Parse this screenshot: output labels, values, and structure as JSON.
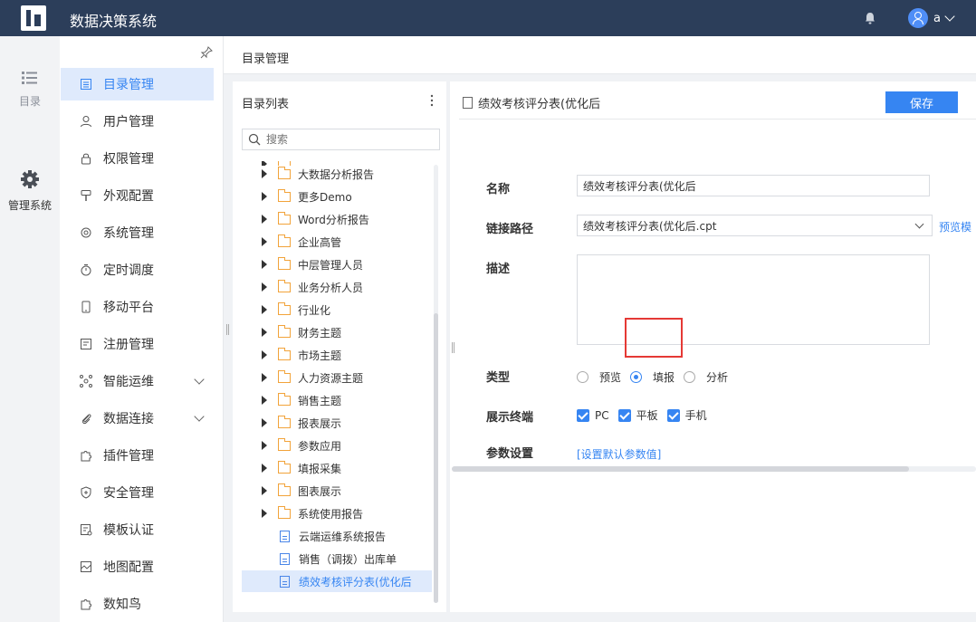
{
  "app": {
    "title": "数据决策系统",
    "user": "a"
  },
  "rail": [
    {
      "label": "目录",
      "icon": "list-icon"
    },
    {
      "label": "管理系统",
      "icon": "gear-icon"
    }
  ],
  "menu": [
    {
      "label": "目录管理",
      "icon": "directory-icon",
      "active": true
    },
    {
      "label": "用户管理",
      "icon": "user-icon"
    },
    {
      "label": "权限管理",
      "icon": "lock-icon"
    },
    {
      "label": "外观配置",
      "icon": "brush-icon"
    },
    {
      "label": "系统管理",
      "icon": "settings-icon"
    },
    {
      "label": "定时调度",
      "icon": "timer-icon"
    },
    {
      "label": "移动平台",
      "icon": "mobile-icon"
    },
    {
      "label": "注册管理",
      "icon": "register-icon"
    },
    {
      "label": "智能运维",
      "icon": "ops-icon",
      "expand": true
    },
    {
      "label": "数据连接",
      "icon": "paperclip-icon",
      "expand": true
    },
    {
      "label": "插件管理",
      "icon": "puzzle-icon"
    },
    {
      "label": "安全管理",
      "icon": "shield-icon"
    },
    {
      "label": "模板认证",
      "icon": "template-icon"
    },
    {
      "label": "地图配置",
      "icon": "map-icon"
    },
    {
      "label": "数知鸟",
      "icon": "puzzle-icon"
    }
  ],
  "main": {
    "header": "目录管理"
  },
  "tree": {
    "title": "目录列表",
    "search_placeholder": "搜索",
    "nodes": [
      {
        "label": "大数据分析报告",
        "type": "folder"
      },
      {
        "label": "更多Demo",
        "type": "folder"
      },
      {
        "label": "Word分析报告",
        "type": "folder"
      },
      {
        "label": "企业高管",
        "type": "folder"
      },
      {
        "label": "中层管理人员",
        "type": "folder"
      },
      {
        "label": "业务分析人员",
        "type": "folder"
      },
      {
        "label": "行业化",
        "type": "folder"
      },
      {
        "label": "财务主题",
        "type": "folder"
      },
      {
        "label": "市场主题",
        "type": "folder"
      },
      {
        "label": "人力资源主题",
        "type": "folder"
      },
      {
        "label": "销售主题",
        "type": "folder"
      },
      {
        "label": "报表展示",
        "type": "folder"
      },
      {
        "label": "参数应用",
        "type": "folder"
      },
      {
        "label": "填报采集",
        "type": "folder"
      },
      {
        "label": "图表展示",
        "type": "folder"
      },
      {
        "label": "系统使用报告",
        "type": "folder"
      },
      {
        "label": "云端运维系统报告",
        "type": "file"
      },
      {
        "label": "销售（调拨）出库单",
        "type": "file"
      },
      {
        "label": "绩效考核评分表(优化后",
        "type": "file",
        "active": true
      }
    ]
  },
  "detail": {
    "doc_title": "绩效考核评分表(优化后",
    "save_label": "保存",
    "labels": {
      "name": "名称",
      "path": "链接路径",
      "desc": "描述",
      "type": "类型",
      "terminal": "展示终端",
      "params": "参数设置"
    },
    "name_value": "绩效考核评分表(优化后",
    "path_value": "绩效考核评分表(优化后.cpt",
    "preview_link": "预览模",
    "type_options": [
      {
        "label": "预览",
        "checked": false
      },
      {
        "label": "填报",
        "checked": true
      },
      {
        "label": "分析",
        "checked": false
      }
    ],
    "terminals": [
      "PC",
      "平板",
      "手机"
    ],
    "params_link": "[设置默认参数值]"
  },
  "colors": {
    "topbar": "#2c3e5a",
    "accent": "#3685f2",
    "highlight": "#e53935"
  }
}
